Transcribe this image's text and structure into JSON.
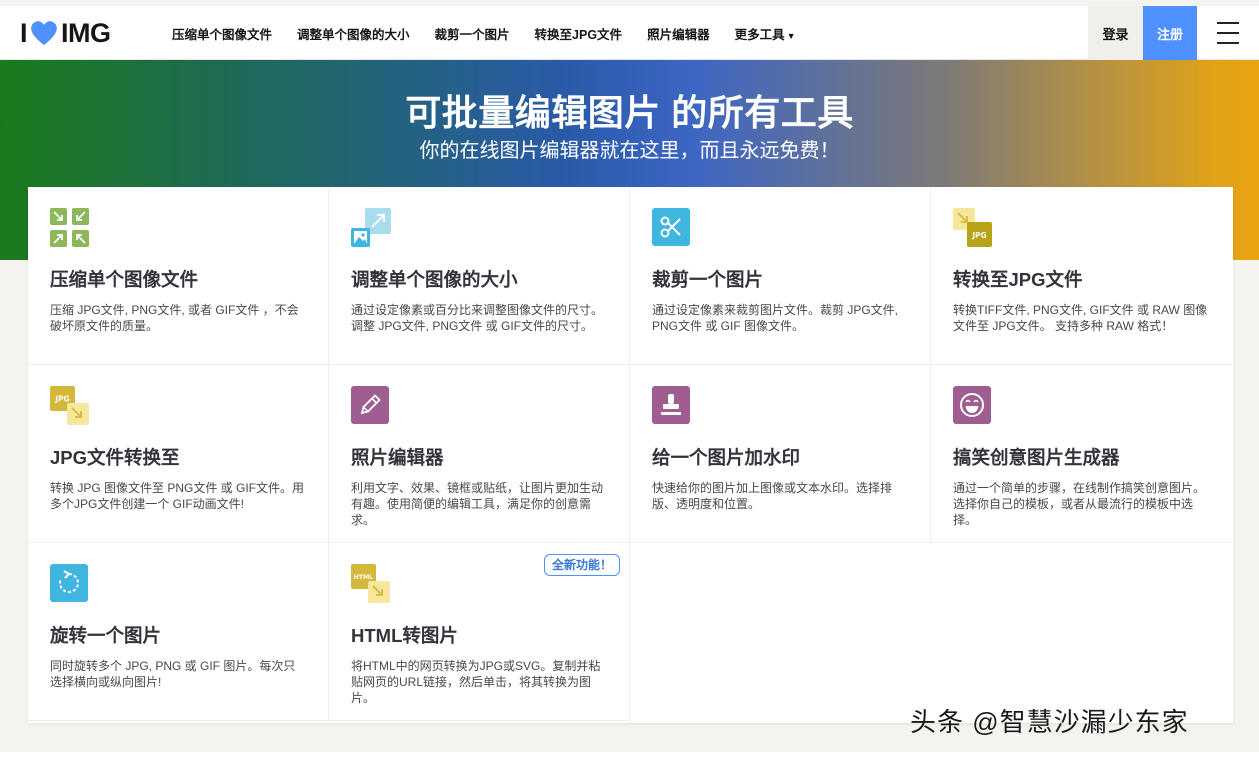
{
  "brand": {
    "logo_left": "I",
    "logo_right": "IMG"
  },
  "nav": {
    "items": [
      "压缩单个图像文件",
      "调整单个图像的大小",
      "裁剪一个图片",
      "转换至JPG文件",
      "照片编辑器"
    ],
    "more": "更多工具",
    "login": "登录",
    "signup": "注册"
  },
  "hero": {
    "title": "可批量编辑图片 的所有工具",
    "subtitle": "你的在线图片编辑器就在这里，而且永远免费！"
  },
  "tools": [
    {
      "title": "压缩单个图像文件",
      "desc": "压缩 JPG文件, PNG文件, 或者 GIF文件 ，不会破坏原文件的质量。",
      "icon": "compress-icon"
    },
    {
      "title": "调整单个图像的大小",
      "desc": "通过设定像素或百分比来调整图像文件的尺寸。 调整 JPG文件, PNG文件 或 GIF文件的尺寸。",
      "icon": "resize-icon"
    },
    {
      "title": "裁剪一个图片",
      "desc": "通过设定像素来裁剪图片文件。裁剪 JPG文件, PNG文件 或 GIF 图像文件。",
      "icon": "scissors-icon"
    },
    {
      "title": "转换至JPG文件",
      "desc": "转换TIFF文件, PNG文件, GIF文件 或 RAW 图像文件至 JPG文件。 支持多种 RAW 格式！",
      "icon": "convert-to-jpg-icon"
    },
    {
      "title": "JPG文件转换至",
      "desc": "转换 JPG 图像文件至 PNG文件 或 GIF文件。用多个JPG文件创建一个 GIF动画文件!",
      "icon": "convert-from-jpg-icon"
    },
    {
      "title": "照片编辑器",
      "desc": "利用文字、效果、镜框或贴纸，让图片更加生动有趣。使用简便的编辑工具，满足你的创意需求。",
      "icon": "pencil-icon"
    },
    {
      "title": "给一个图片加水印",
      "desc": "快速给你的图片加上图像或文本水印。选择排版、透明度和位置。",
      "icon": "stamp-icon"
    },
    {
      "title": "搞笑创意图片生成器",
      "desc": "通过一个简单的步骤，在线制作搞笑创意图片。选择你自己的模板，或者从最流行的模板中选择。",
      "icon": "laughing-face-icon"
    },
    {
      "title": "旋转一个图片",
      "desc": "同时旋转多个 JPG, PNG 或 GIF 图片。每次只选择横向或纵向图片!",
      "icon": "rotate-icon"
    },
    {
      "title": "HTML转图片",
      "desc": "将HTML中的网页转换为JPG或SVG。复制并粘贴网页的URL链接，然后单击，将其转换为图片。",
      "icon": "html-to-image-icon"
    }
  ],
  "badge": "全新功能！",
  "watermark": "头条 @智慧沙漏少东家",
  "colors": {
    "accent": "#4d90fe",
    "heart": "#4d90fe",
    "green": "#8cb75a",
    "blue": "#3fb5e0",
    "yellow": "#d4b83a",
    "purple": "#a05d92"
  }
}
